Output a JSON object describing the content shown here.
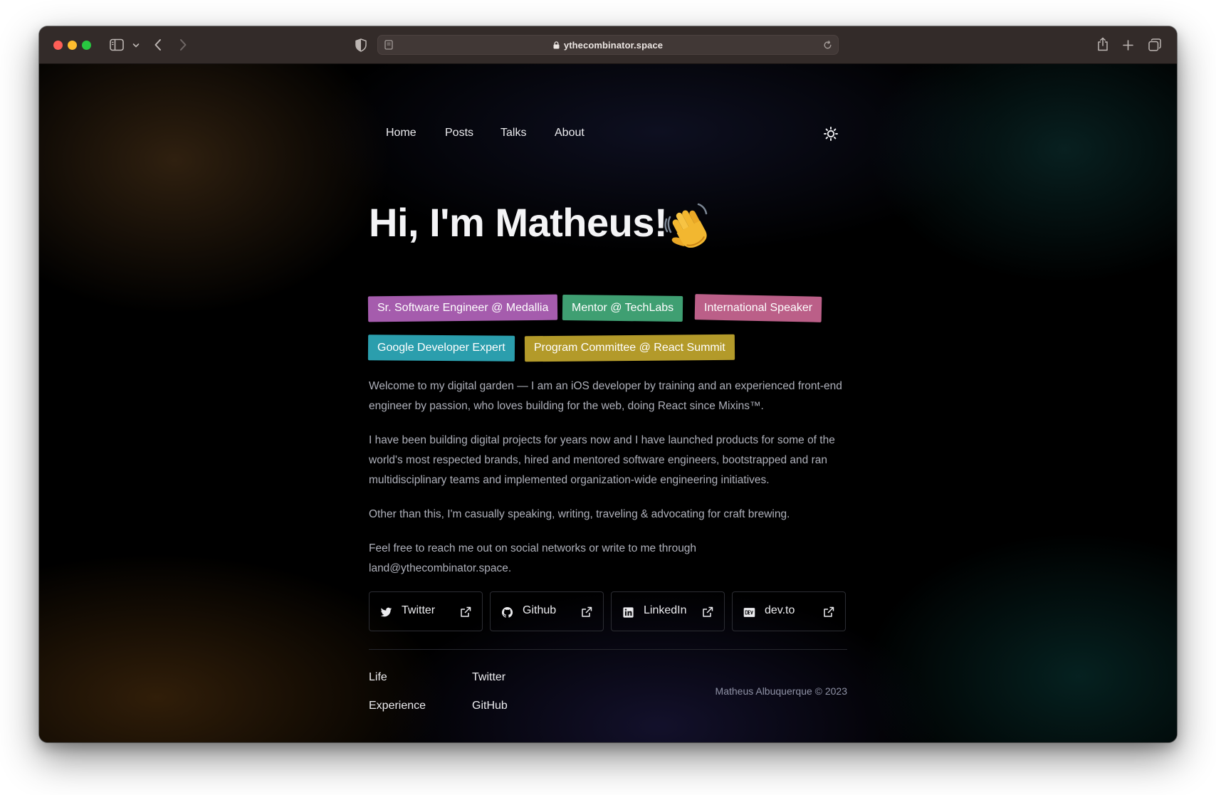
{
  "browser": {
    "url": "ythecombinator.space"
  },
  "nav": {
    "items": [
      {
        "label": "Home"
      },
      {
        "label": "Posts"
      },
      {
        "label": "Talks"
      },
      {
        "label": "About"
      }
    ]
  },
  "hero": {
    "title": "Hi, I'm Matheus!",
    "emoji": "waving-hand"
  },
  "tags": [
    {
      "label": "Sr. Software Engineer @ Medallia",
      "color": "#a55cad"
    },
    {
      "label": "Mentor @ TechLabs",
      "color": "#3f9f72"
    },
    {
      "label": "International Speaker",
      "color": "#bb5f88"
    },
    {
      "label": "Google Developer Expert",
      "color": "#2b9ead"
    },
    {
      "label": "Program Committee @ React Summit",
      "color": "#b39a2a"
    }
  ],
  "paragraphs": [
    "Welcome to my digital garden — I am an iOS developer by training and an experienced front-end engineer by passion, who loves building for the web, doing React since Mixins™.",
    "I have been building digital projects for years now and I have launched products for some of the world's most respected brands, hired and mentored software engineers, bootstrapped and ran multidisciplinary teams and implemented organization-wide engineering initiatives.",
    "Other than this, I'm casually speaking, writing, traveling & advocating for craft brewing.",
    "Feel free to reach me out on social networks or write to me through land@ythecombinator.space."
  ],
  "social": [
    {
      "label": "Twitter",
      "icon": "twitter-icon"
    },
    {
      "label": "Github",
      "icon": "github-icon"
    },
    {
      "label": "LinkedIn",
      "icon": "linkedin-icon"
    },
    {
      "label": "dev.to",
      "icon": "devto-icon"
    }
  ],
  "footer": {
    "links_col1": [
      "Life",
      "Experience"
    ],
    "links_col2": [
      "Twitter",
      "GitHub"
    ],
    "copyright": "Matheus Albuquerque © 2023"
  }
}
